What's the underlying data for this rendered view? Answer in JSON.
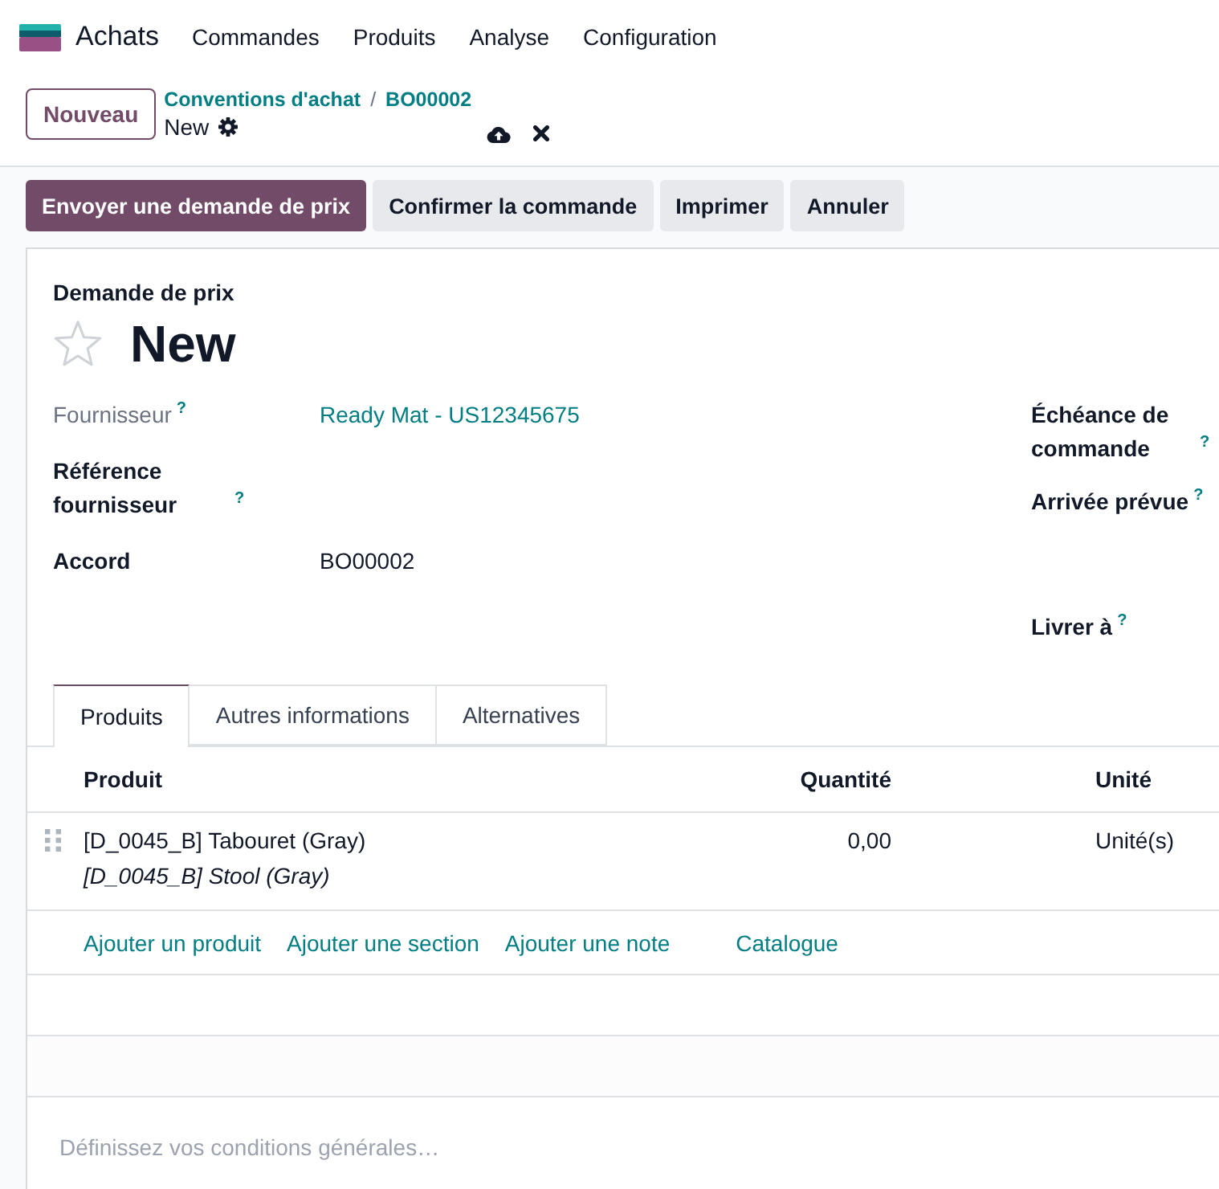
{
  "navbar": {
    "app_name": "Achats",
    "menu": [
      "Commandes",
      "Produits",
      "Analyse",
      "Configuration"
    ]
  },
  "control_panel": {
    "new_button": "Nouveau",
    "breadcrumbs": [
      "Conventions d'achat",
      "BO00002"
    ],
    "breadcrumb_separator": "/",
    "record_name": "New"
  },
  "actions": [
    {
      "label": "Envoyer une demande de prix",
      "kind": "primary"
    },
    {
      "label": "Confirmer la commande",
      "kind": "secondary"
    },
    {
      "label": "Imprimer",
      "kind": "secondary"
    },
    {
      "label": "Annuler",
      "kind": "secondary"
    }
  ],
  "form": {
    "subtitle": "Demande de prix",
    "title": "New",
    "starred": false,
    "left_fields": [
      {
        "label": "Fournisseur",
        "help": "?",
        "muted": true,
        "value": "Ready Mat - US12345675",
        "kind": "link"
      },
      {
        "label": "Référence fournisseur",
        "help": "?",
        "muted": false
      },
      {
        "label": "Accord",
        "muted": false,
        "value": "BO00002",
        "kind": "text"
      }
    ],
    "right_fields": [
      {
        "label": "Échéance de commande",
        "help": "?"
      },
      {
        "label": "Arrivée prévue",
        "help": "?"
      },
      {
        "label": "Livrer à",
        "help": "?"
      }
    ]
  },
  "tabs": [
    {
      "label": "Produits",
      "selected": true
    },
    {
      "label": "Autres informations",
      "selected": false
    },
    {
      "label": "Alternatives",
      "selected": false
    }
  ],
  "order_lines": {
    "columns": [
      "Produit",
      "Quantité",
      "Unité"
    ],
    "rows": [
      {
        "product": "[D_0045_B] Tabouret (Gray)",
        "description": "[D_0045_B] Stool (Gray)",
        "quantity": "0,00",
        "unit": "Unité(s)"
      }
    ],
    "add_links": [
      "Ajouter un produit",
      "Ajouter une section",
      "Ajouter une note",
      "Catalogue"
    ]
  },
  "terms": {
    "placeholder": "Définissez vos conditions générales…"
  }
}
